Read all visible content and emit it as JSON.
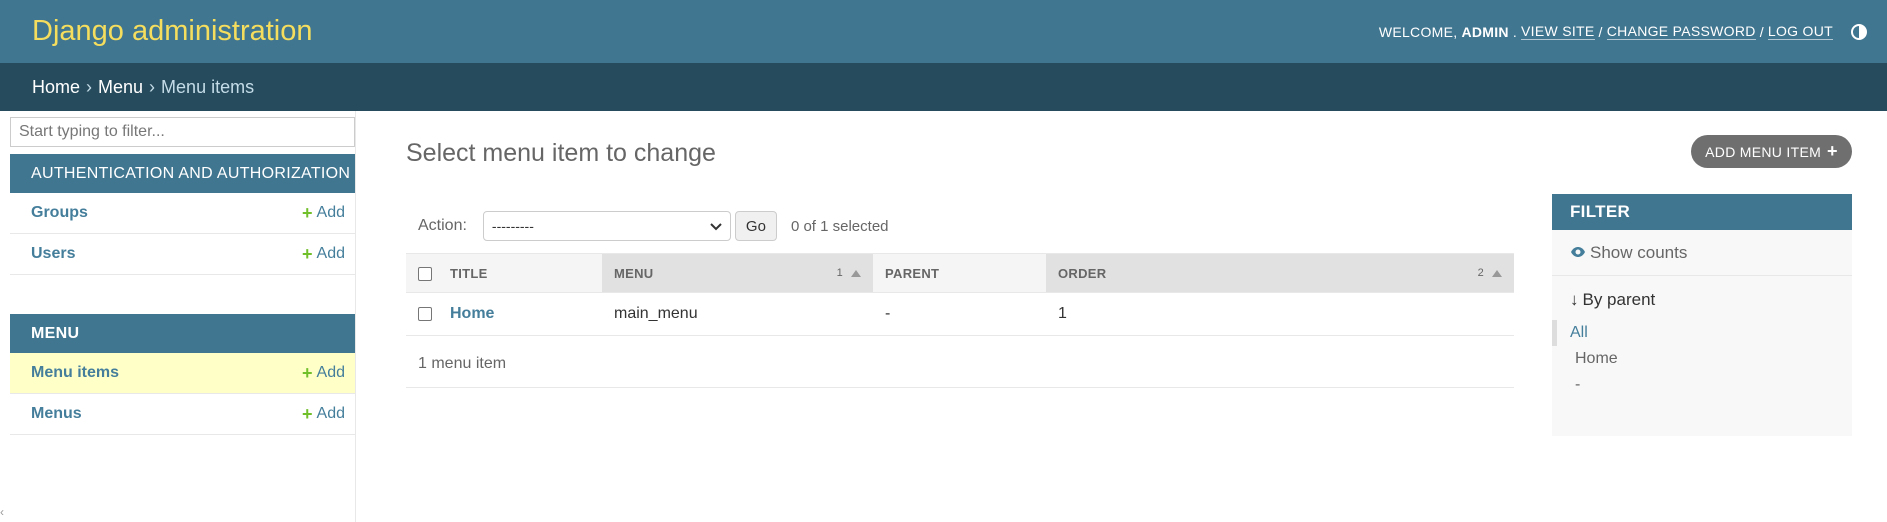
{
  "header": {
    "branding": "Django administration",
    "welcome_prefix": "Welcome,",
    "username": "admin",
    "links": {
      "view_site": "View site",
      "change_password": "Change password",
      "log_out": "Log out"
    },
    "separator": "/"
  },
  "breadcrumbs": {
    "items": [
      {
        "label": "Home"
      },
      {
        "label": "Menu"
      },
      {
        "label": "Menu items"
      }
    ],
    "separator": "›"
  },
  "sidebar": {
    "filter_placeholder": "Start typing to filter...",
    "add_label": "Add",
    "modules": [
      {
        "caption": "Authentication and Authorization",
        "models": [
          {
            "label": "Groups"
          },
          {
            "label": "Users"
          }
        ]
      },
      {
        "caption": "Menu",
        "models": [
          {
            "label": "Menu items",
            "current": true
          },
          {
            "label": "Menus"
          }
        ]
      }
    ]
  },
  "content": {
    "title": "Select menu item to change",
    "add_button": "Add menu item",
    "actions": {
      "label": "Action:",
      "select_value": "---------",
      "go_label": "Go",
      "selected_count": "0 of 1 selected"
    },
    "table": {
      "headers": [
        {
          "label": "Title"
        },
        {
          "label": "Menu",
          "sort_priority": "1"
        },
        {
          "label": "Parent"
        },
        {
          "label": "Order",
          "sort_priority": "2"
        }
      ],
      "rows": [
        {
          "title": "Home",
          "menu": "main_menu",
          "parent": "-",
          "order": "1"
        }
      ]
    },
    "paginator": "1 menu item"
  },
  "filter": {
    "title": "Filter",
    "show_counts": "Show counts",
    "by_label": "By parent",
    "choices": [
      {
        "label": "All",
        "selected": true
      },
      {
        "label": "Home"
      },
      {
        "label": "-"
      }
    ]
  },
  "colors": {
    "header_bg": "#417690",
    "branding": "#f5dd5d",
    "breadcrumbs_bg": "#264b5d",
    "link": "#447e9b",
    "add_icon": "#70bf2b",
    "current_row": "#ffffc8"
  }
}
